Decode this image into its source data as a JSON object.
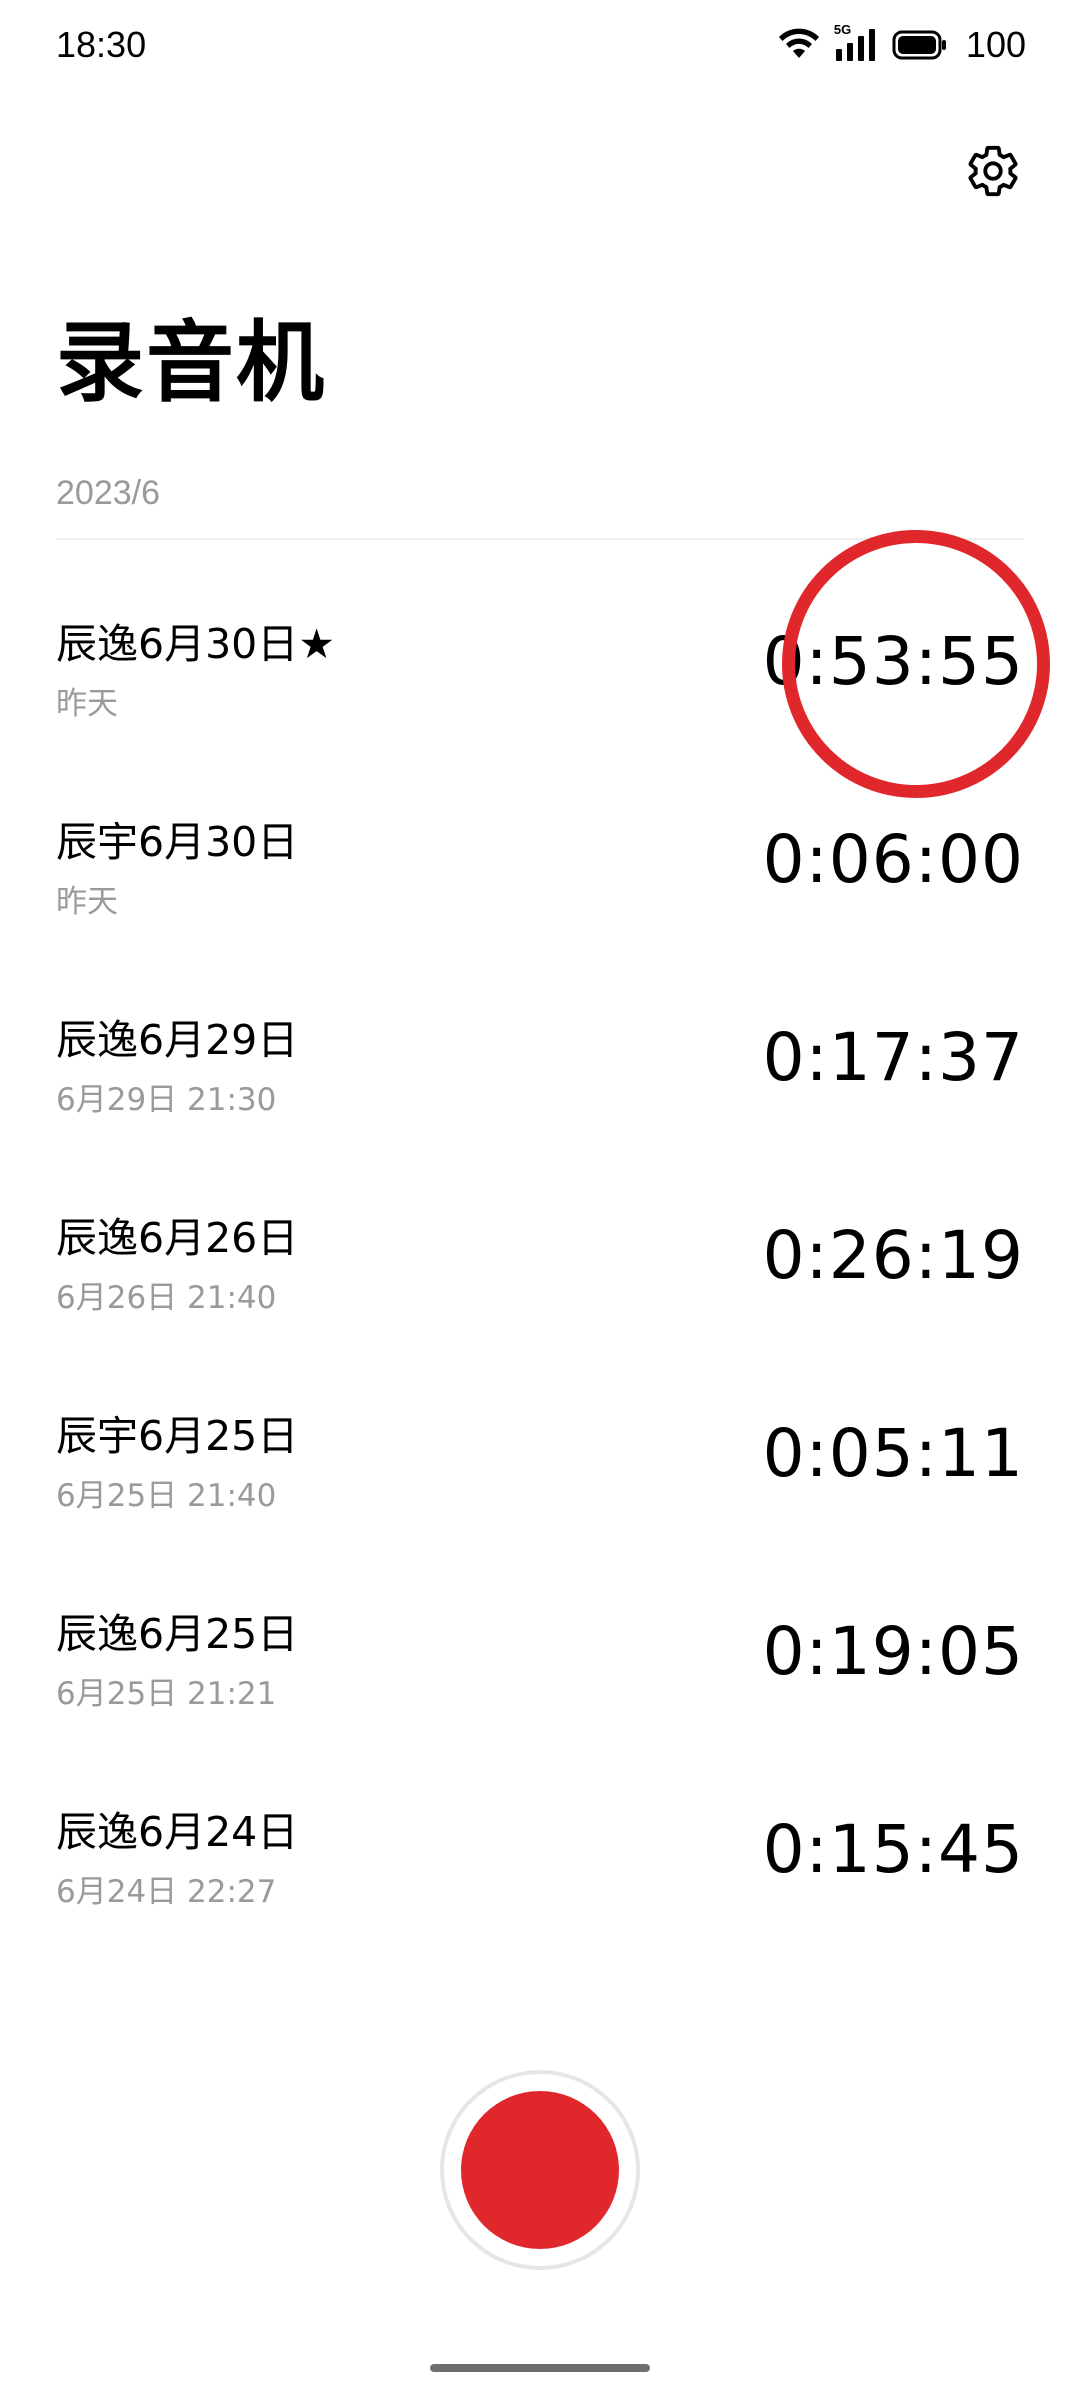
{
  "status_bar": {
    "time": "18:30",
    "network": "5G",
    "battery": "100",
    "icons": [
      "wifi-icon",
      "signal-5g-icon",
      "battery-icon"
    ]
  },
  "header": {
    "settings_icon": "gear-icon",
    "title": "录音机"
  },
  "month_header": "2023/6",
  "recordings": [
    {
      "name": "辰逸6月30日★",
      "date": "昨天",
      "duration": "0:53:55"
    },
    {
      "name": "辰宇6月30日",
      "date": "昨天",
      "duration": "0:06:00"
    },
    {
      "name": "辰逸6月29日",
      "date": "6月29日 21:30",
      "duration": "0:17:37"
    },
    {
      "name": "辰逸6月26日",
      "date": "6月26日 21:40",
      "duration": "0:26:19"
    },
    {
      "name": "辰宇6月25日",
      "date": "6月25日 21:40",
      "duration": "0:05:11"
    },
    {
      "name": "辰逸6月25日",
      "date": "6月25日 21:21",
      "duration": "0:19:05"
    },
    {
      "name": "辰逸6月24日",
      "date": "6月24日 22:27",
      "duration": "0:15:45"
    }
  ],
  "colors": {
    "accent_red": "#e0282c",
    "secondary_text": "#9a9a9a",
    "divider": "#efefef"
  },
  "record_button": {
    "icon": "record-icon"
  }
}
